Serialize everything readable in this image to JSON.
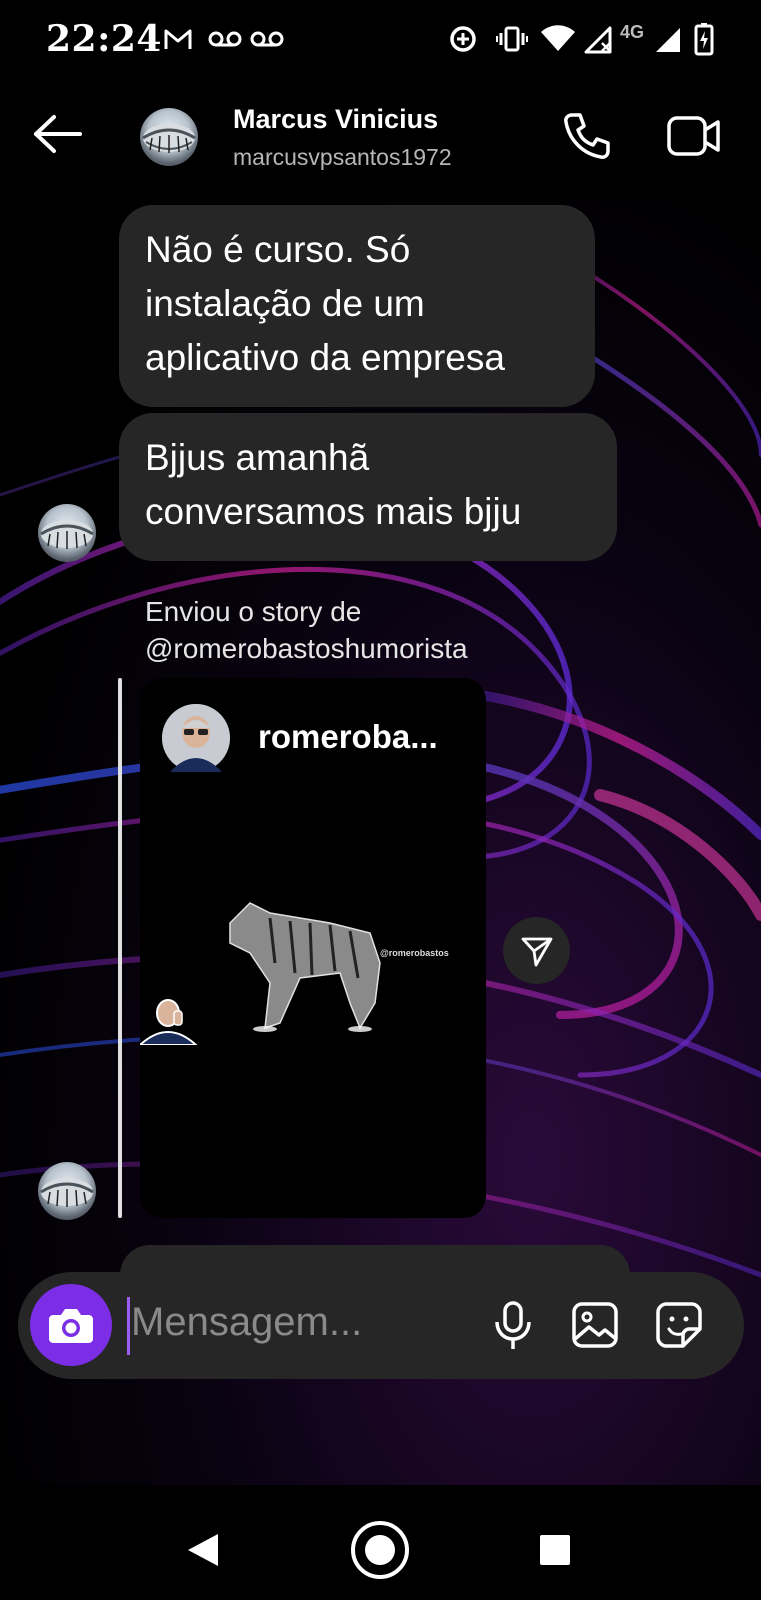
{
  "status_bar": {
    "time": "22:24",
    "network": "4G"
  },
  "header": {
    "name": "Marcus Vinicius",
    "username": "marcusvpsantos1972"
  },
  "messages": [
    {
      "text_lines": [
        "Não é curso. Só",
        "instalação de um",
        "aplicativo da empresa"
      ]
    },
    {
      "text_lines": [
        "Bjjus amanhã",
        "conversamos mais bjju"
      ]
    }
  ],
  "story_share": {
    "caption_line1": "Enviou o story de",
    "caption_line2": "@romerobastoshumorista",
    "story_username": "romeroba...",
    "watermark": "@romerobastos"
  },
  "composer": {
    "placeholder": "Mensagem..."
  },
  "colors": {
    "bubble": "#262626",
    "accent": "#7c2ee6"
  }
}
